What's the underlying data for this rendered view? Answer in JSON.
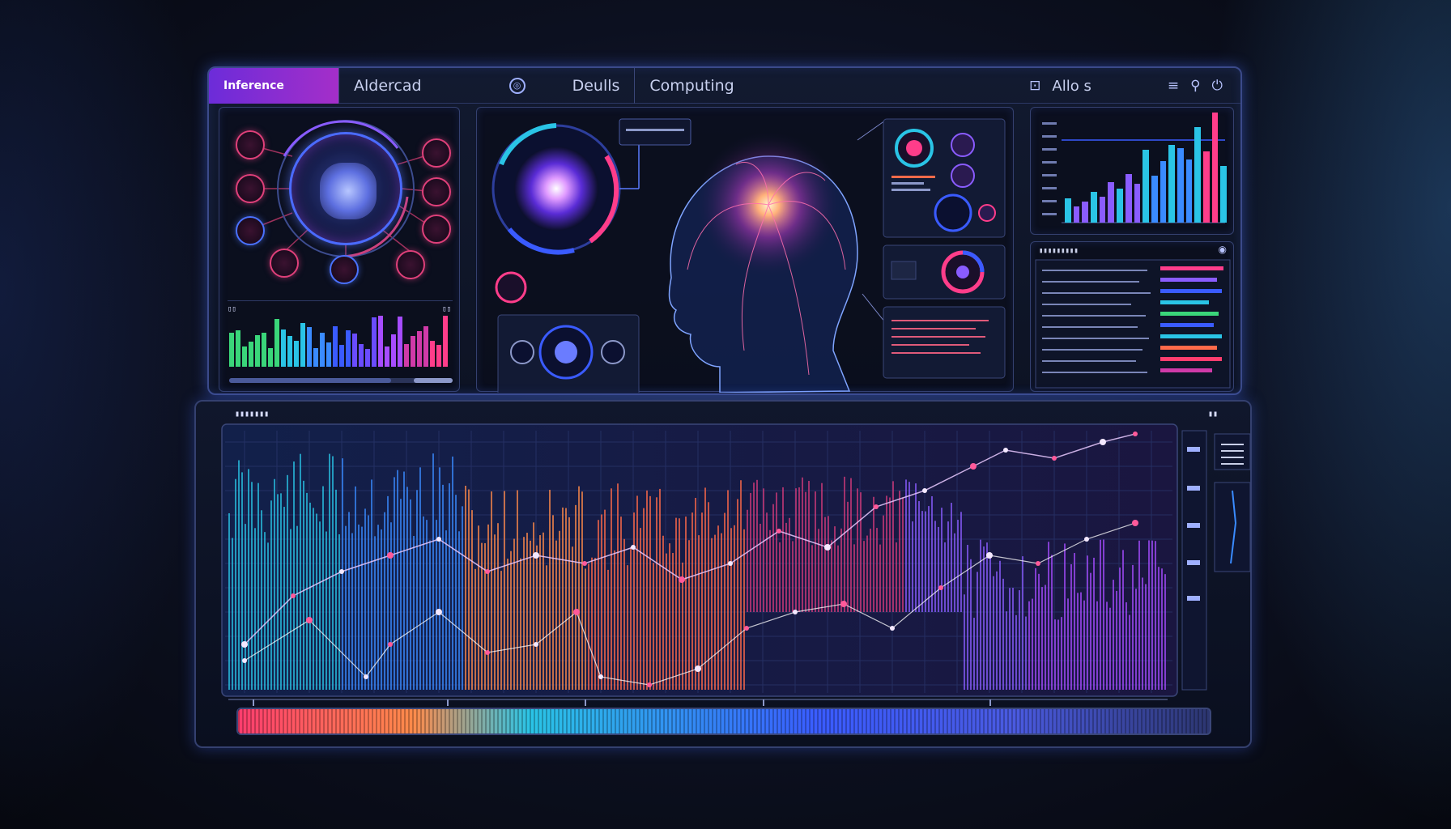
{
  "window": {
    "tabs": [
      {
        "label": "Inference",
        "active": true
      },
      {
        "label": "Aldercad",
        "active": false
      },
      {
        "label": "Deulls",
        "active": false
      },
      {
        "label": "Computing",
        "active": false
      }
    ],
    "right_label": "Allo s",
    "icons": [
      "chat-icon",
      "pin-icon",
      "power-icon"
    ]
  },
  "left_panel": {
    "chart_label_left": "▯▯",
    "chart_label_right": "▯▯"
  },
  "right_panel": {
    "list_header": "▮▮▮▮▮▮▮▮▮"
  },
  "bottom_panel": {
    "title": "▮▮▮▮▮▮▮",
    "badge": "▮▮"
  },
  "colors": {
    "accent": "#a42ec9",
    "blue": "#3a5bff",
    "pink": "#ff3d8a",
    "cyan": "#2ac4e6",
    "orange": "#ff8a4a"
  }
}
